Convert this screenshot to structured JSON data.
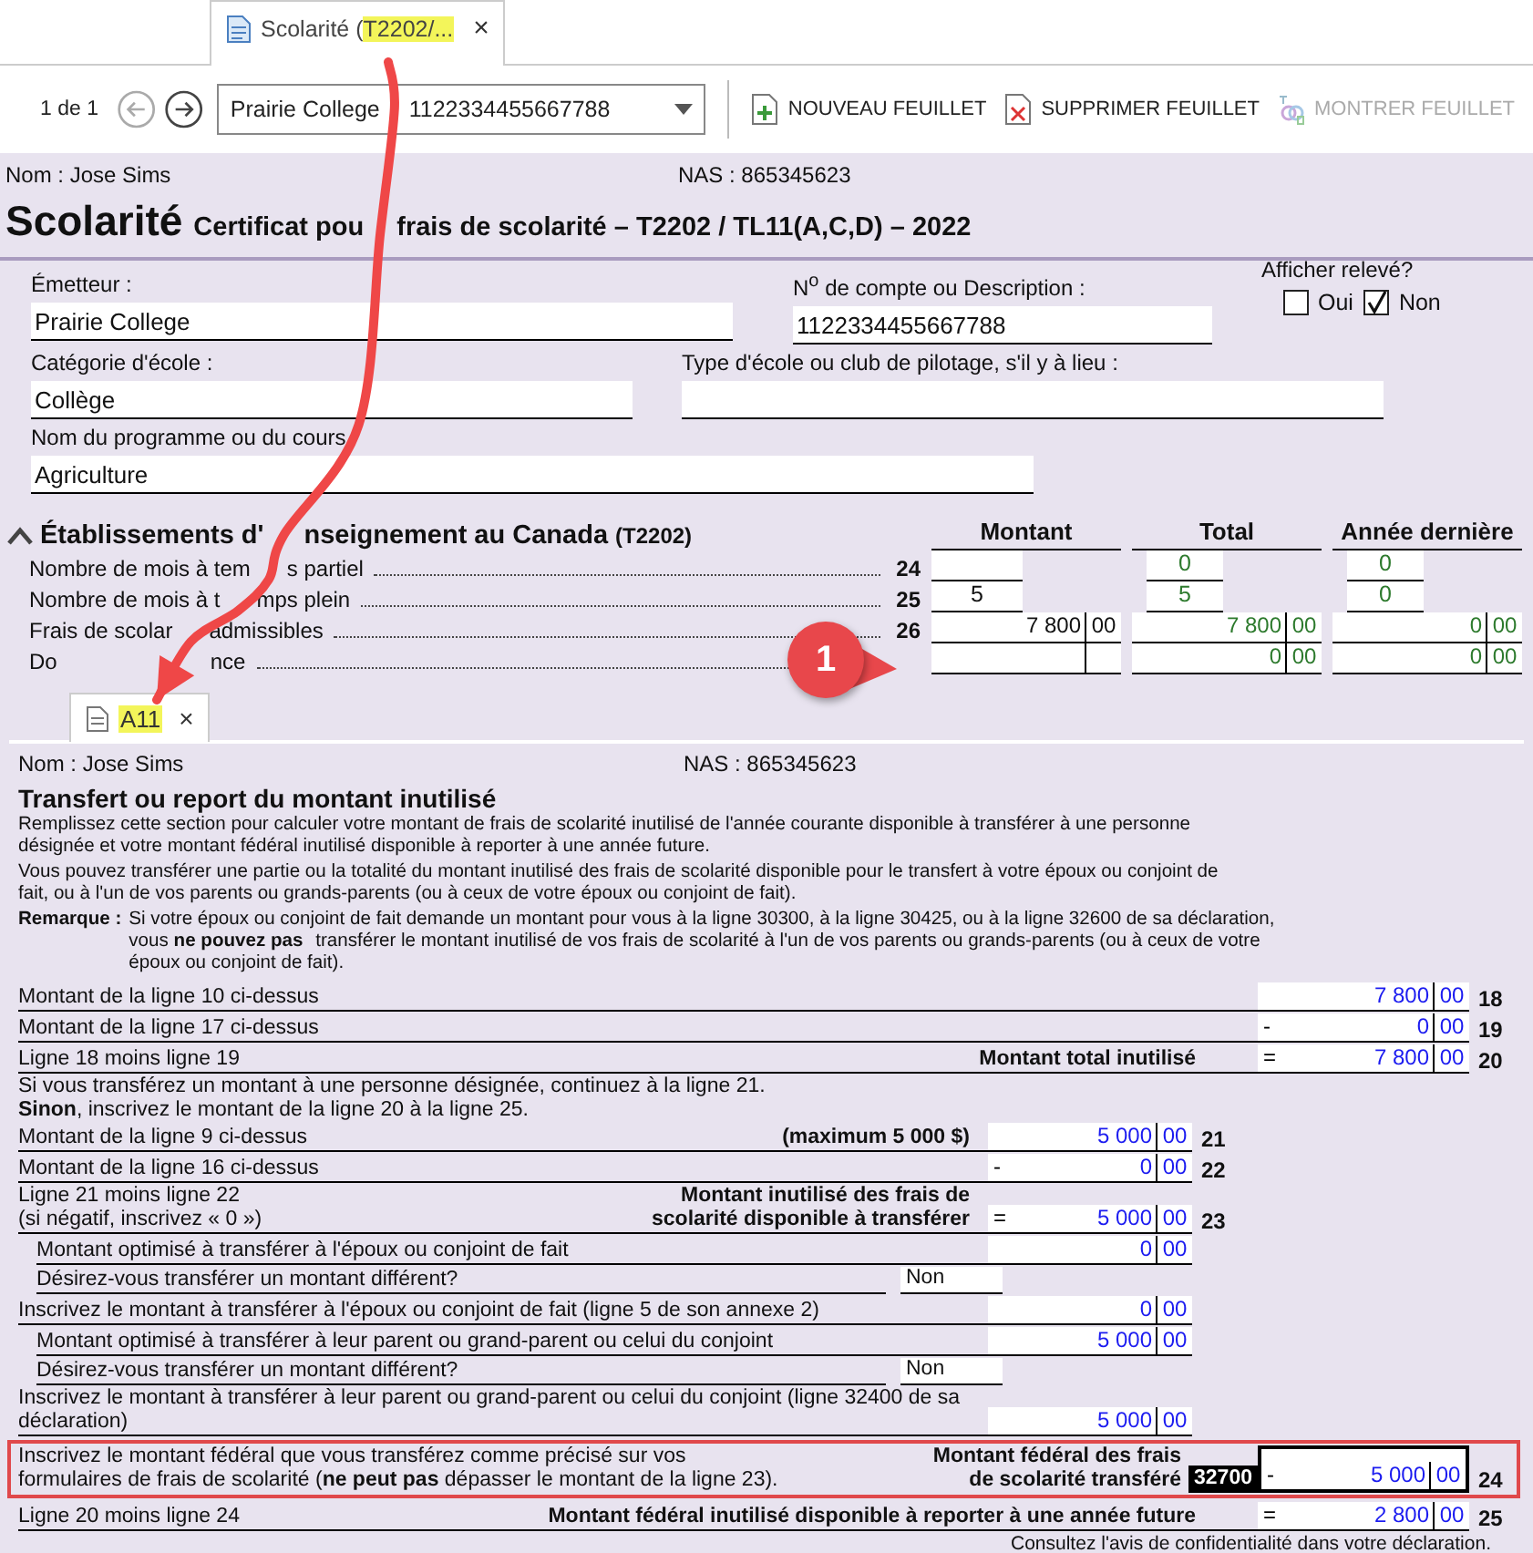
{
  "tab": {
    "label": "Scolarité (",
    "highlight": "T2202/...",
    "close": "×",
    "selected": true
  },
  "toolbar": {
    "page": "1 de 1",
    "sheet_start": "Prairie College",
    "sheet_end": "1122334455667788",
    "buttons": [
      {
        "kind": "new",
        "label": "NOUVEAU FEUILLET",
        "disabled": false
      },
      {
        "kind": "delete",
        "label": "SUPPRIMER FEUILLET",
        "disabled": false
      },
      {
        "kind": "show",
        "label": "MONTRER FEUILLET",
        "disabled": true
      }
    ]
  },
  "header": {
    "name": "Nom : Jose Sims",
    "sin": "NAS : 865345623",
    "title": "Scolarité",
    "subtitle_start": "Certificat pou",
    "subtitle_end": "frais de scolarité – T2202 / TL11(A,C,D) – 2022"
  },
  "fields": [
    {
      "label": "Émetteur :",
      "value": "Prairie College"
    },
    {
      "label": "N$^{o}$ de compte ou Description :",
      "value": "1122334455667788"
    },
    {
      "label": "Catégorie d'école :",
      "value": "Collège"
    },
    {
      "label": "Type d'école ou club de pilotage, s'il y à lieu :"
    },
    {
      "label": "Nom du programme ou du cours",
      "value": "Agriculture"
    }
  ],
  "show_slip": {
    "label": "Afficher relevé?",
    "options": [
      {
        "label": "Oui",
        "selected": false
      },
      {
        "label": "Non",
        "selected": true
      }
    ]
  },
  "canada": {
    "title_start": "Établissements d'",
    "title_end": "nseignement au Canada",
    "code": "(T2202)",
    "expanded": true,
    "columns": [
      "Montant",
      "Total",
      "Année dernière"
    ],
    "rows": [
      {
        "kind": "count",
        "label": "Nombre de mois à tem",
        "label_end": "s partiel",
        "line": "24",
        "cells": [
          null,
          {
            "dollars": "0"
          },
          {
            "dollars": "0"
          }
        ]
      },
      {
        "kind": "count",
        "label": "Nombre de mois à t",
        "label_end": "mps plein",
        "line": "25",
        "cells": [
          {
            "dollars": "5"
          },
          {
            "dollars": "5"
          },
          {
            "dollars": "0"
          }
        ]
      },
      {
        "kind": "amount",
        "label": "Frais de scolar",
        "label_end": "admissibles",
        "line": "26",
        "cells": [
          {
            "dollars": "7 800",
            "cents": "00"
          },
          {
            "dollars": "7 800",
            "cents": "00"
          },
          {
            "dollars": "0",
            "cents": "00"
          }
        ]
      },
      {
        "kind": "amount",
        "label": "Do",
        "label_end": "nce",
        "cells": [
          null,
          {
            "dollars": "0",
            "cents": "00"
          },
          {
            "dollars": "0",
            "cents": "00"
          }
        ]
      }
    ]
  },
  "a11": {
    "tab": "A11",
    "close": "×",
    "name": "Nom : Jose Sims",
    "sin": "NAS : 865345623",
    "title": "Transfert ou report du montant inutilisé",
    "paragraphs": [
      "Remplissez cette section pour calculer votre montant de frais de scolarité inutilisé de l'année courante disponible à transférer à une personne désignée et votre montant fédéral inutilisé disponible à reporter à une année future.",
      "Vous pouvez transférer une partie ou la totalité du montant inutilisé des frais de scolarité disponible pour le transfert à votre époux ou conjoint de fait, ou à l'un de vos parents ou grands-parents (ou à ceux de votre époux ou conjoint de fait)."
    ],
    "remark": {
      "label": "Remarque :",
      "text": "Si votre époux ou conjoint de fait demande un montant pour vous à la ligne 30300, à la ligne 30425, ou à la ligne 32600 de sa déclaration, vous **ne pouvez pas** transférer le montant inutilisé de vos frais de scolarité à l'un de vos parents ou grands-parents (ou à ceux de votre époux ou conjoint de fait)."
    },
    "rows": [
      {
        "kind": "outer",
        "label": "Montant de la ligne 10 ci-dessus",
        "value": {
          "dollars": "7 800",
          "cents": "00"
        },
        "line": "18"
      },
      {
        "kind": "outer",
        "label": "Montant de la ligne 17 ci-dessus",
        "sign": "-",
        "value": {
          "dollars": "0",
          "cents": "00"
        },
        "line": "19"
      },
      {
        "kind": "outer",
        "label": "Ligne 18 moins ligne 19",
        "bold": "Montant total inutilisé",
        "sign": "=",
        "value": {
          "dollars": "7 800",
          "cents": "00"
        },
        "line": "20"
      },
      {
        "kind": "note",
        "text": "Si vous transférez un montant à une personne désignée, continuez à la ligne 21."
      },
      {
        "kind": "note",
        "text": "**Sinon**, inscrivez le montant de la ligne 20 à la ligne 25."
      },
      {
        "kind": "inner",
        "label": "Montant de la ligne 9 ci-dessus",
        "bold": "(maximum 5 000 $)",
        "value": {
          "dollars": "5 000",
          "cents": "00"
        },
        "line": "21"
      },
      {
        "kind": "inner",
        "label": "Montant de la ligne 16 ci-dessus",
        "sign": "-",
        "value": {
          "dollars": "0",
          "cents": "00"
        },
        "line": "22"
      },
      {
        "kind": "inner",
        "label": "Ligne 21 moins ligne 22",
        "label2": "(si négatif, inscrivez « 0 »)",
        "bold": "Montant inutilisé des frais de",
        "bold2": "scolarité disponible à transférer",
        "sign": "=",
        "value": {
          "dollars": "5 000",
          "cents": "00"
        },
        "line": "23"
      },
      {
        "kind": "inner",
        "indent": true,
        "label": "Montant optimisé à transférer à l'époux ou conjoint de fait",
        "value": {
          "dollars": "0",
          "cents": "00"
        }
      },
      {
        "kind": "question",
        "indent": true,
        "label": "Désirez-vous transférer un montant différent?",
        "answer": "Non"
      },
      {
        "kind": "inner",
        "label": "Inscrivez le montant à transférer à l'époux ou conjoint de fait (ligne 5 de son annexe 2)",
        "value": {
          "dollars": "0",
          "cents": "00"
        }
      },
      {
        "kind": "inner",
        "indent": true,
        "label": "Montant optimisé à transférer à leur parent ou grand-parent ou celui du conjoint",
        "value": {
          "dollars": "5 000",
          "cents": "00"
        }
      },
      {
        "kind": "question",
        "indent": true,
        "label": "Désirez-vous transférer un montant différent?",
        "answer": "Non"
      },
      {
        "kind": "inner",
        "label": "Inscrivez le montant à transférer à leur parent ou grand-parent ou celui du conjoint (ligne 32400 de sa déclaration)",
        "value": {
          "dollars": "5 000",
          "cents": "00"
        }
      },
      {
        "kind": "outer",
        "highlighted": true,
        "focused": true,
        "label": "Inscrivez le montant fédéral que vous transférez comme précisé sur vos formulaires de frais de scolarité (**ne peut pas** dépasser le montant de la ligne 23).",
        "bold": "Montant fédéral des frais",
        "bold2": "de scolarité transféré",
        "code": "32700",
        "sign": "-",
        "value": {
          "dollars": "5 000",
          "cents": "00"
        },
        "line": "24"
      },
      {
        "kind": "outer",
        "label": "Ligne 20 moins ligne 24",
        "bold": "Montant fédéral inutilisé disponible à reporter à une année future",
        "sign": "=",
        "value": {
          "dollars": "2 800",
          "cents": "00"
        },
        "line": "25"
      }
    ],
    "footer": "Consultez l'avis de confidentialité dans votre déclaration."
  },
  "annotations": {
    "callout": "1"
  }
}
